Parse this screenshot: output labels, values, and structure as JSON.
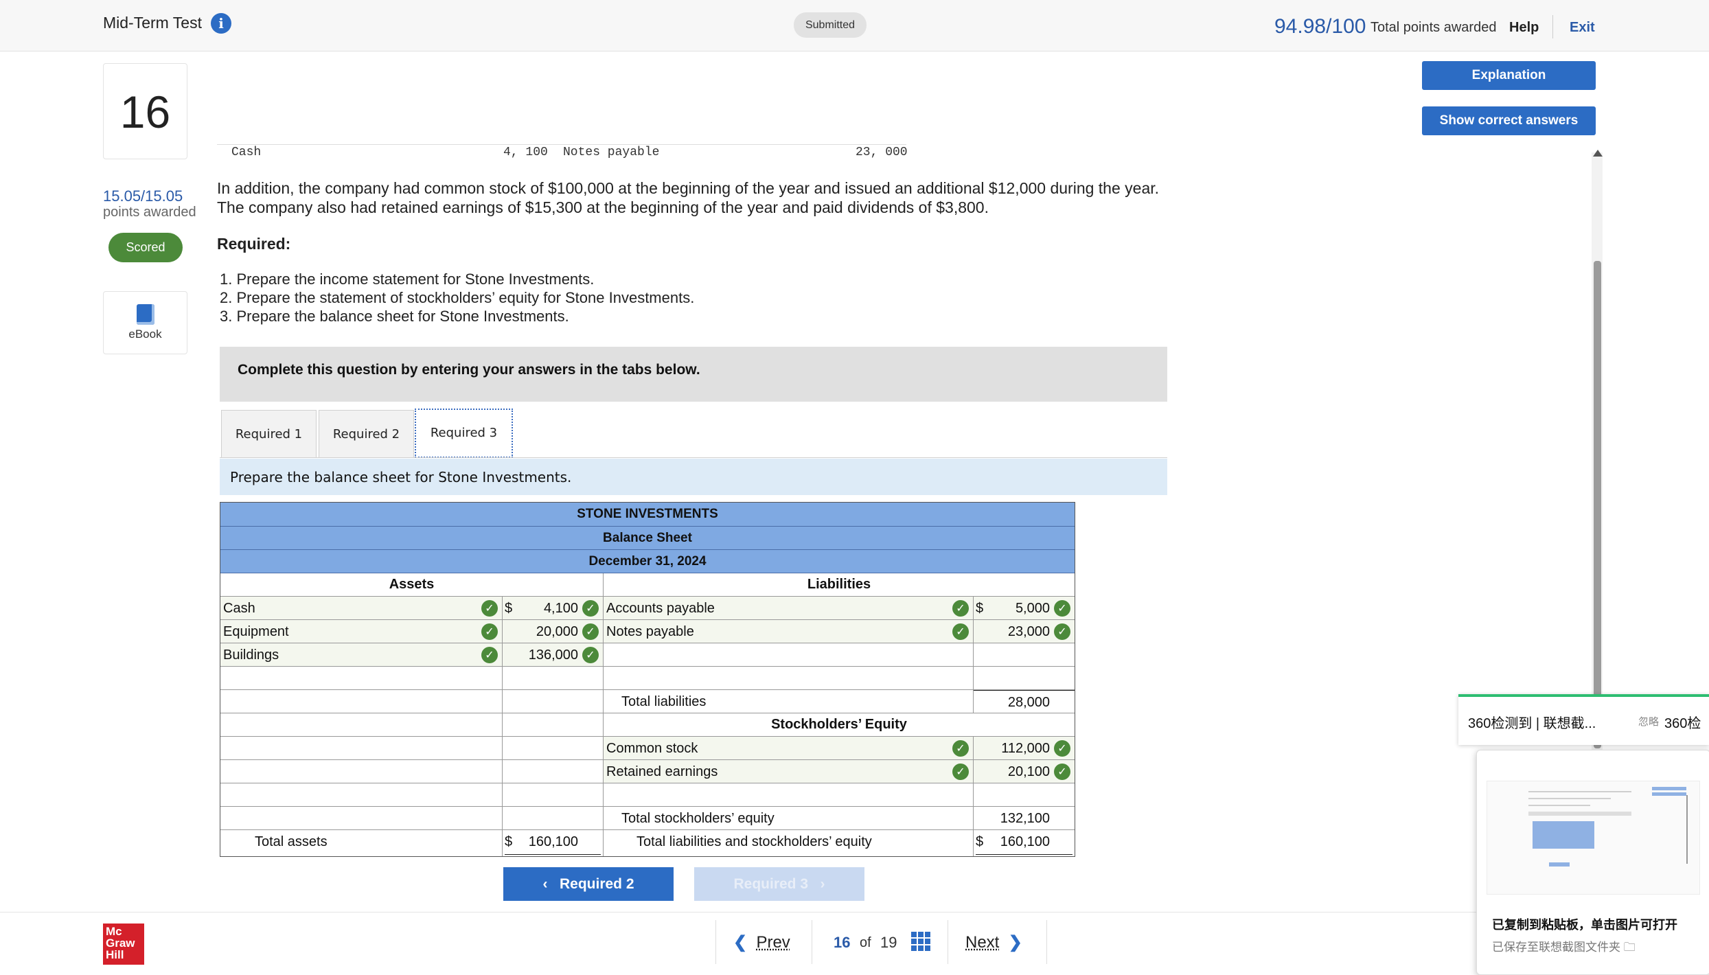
{
  "header": {
    "test_title": "Mid-Term Test",
    "info_icon": "i",
    "status_badge": "Submitted",
    "total_score": "94.98/100",
    "total_score_label": "Total points awarded",
    "help": "Help",
    "exit": "Exit"
  },
  "question": {
    "number": "16",
    "points": "15.05/15.05",
    "points_label": "points awarded",
    "status": "Scored",
    "ebook_label": "eBook"
  },
  "content": {
    "fragment": {
      "left_label": "Cash",
      "left_value": "4, 100",
      "right_label": "Notes payable",
      "right_value": "23, 000"
    },
    "paragraph": "In addition, the company had common stock of $100,000 at the beginning of the year and issued an additional $12,000 during the year. The company also had retained earnings of $15,300 at the beginning of the year and paid dividends of $3,800.",
    "required_label": "Required:",
    "required_items": [
      "1. Prepare the income statement for Stone Investments.",
      "2. Prepare the statement of stockholders’ equity for Stone Investments.",
      "3. Prepare the balance sheet for Stone Investments."
    ],
    "instruction": "Complete this question by entering your answers in the tabs below.",
    "tabs": [
      "Required 1",
      "Required 2",
      "Required 3"
    ],
    "prompt": "Prepare the balance sheet for Stone Investments."
  },
  "balance_sheet": {
    "company": "STONE INVESTMENTS",
    "statement": "Balance Sheet",
    "date": "December 31, 2024",
    "assets_header": "Assets",
    "liabilities_header": "Liabilities",
    "equity_header": "Stockholders’ Equity",
    "currency": "$",
    "assets": [
      {
        "label": "Cash",
        "value": "4,100"
      },
      {
        "label": "Equipment",
        "value": "20,000"
      },
      {
        "label": "Buildings",
        "value": "136,000"
      }
    ],
    "liabilities": [
      {
        "label": "Accounts payable",
        "value": "5,000"
      },
      {
        "label": "Notes payable",
        "value": "23,000"
      }
    ],
    "total_liabilities_label": "Total liabilities",
    "total_liabilities": "28,000",
    "equity": [
      {
        "label": "Common stock",
        "value": "112,000"
      },
      {
        "label": "Retained earnings",
        "value": "20,100"
      }
    ],
    "total_equity_label": "Total stockholders’ equity",
    "total_equity": "132,100",
    "total_assets_label": "Total assets",
    "total_assets": "160,100",
    "total_le_label": "Total liabilities and stockholders’ equity",
    "total_le": "160,100"
  },
  "tab_nav": {
    "prev_label": "Required 2",
    "next_label": "Required 3"
  },
  "side_buttons": {
    "explanation": "Explanation",
    "show_answers": "Show correct answers"
  },
  "footer": {
    "logo": "Mc Graw Hill",
    "prev": "Prev",
    "current": "16",
    "of": "of",
    "total": "19",
    "next": "Next"
  },
  "popup": {
    "banner_main": "360检测到 | 联想截...",
    "banner_dismiss": "忽略",
    "banner_right": "360检",
    "title": "已复制到粘贴板，单击图片可打开",
    "subtitle": "已保存至联想截图文件夹"
  },
  "colors": {
    "accent": "#2c6cc4",
    "score_text": "#2a5aa8",
    "scored_badge": "#4c8a3a",
    "table_header": "#7fa9e2",
    "prompt_bar": "#ddebf7",
    "check": "#4c8a3a"
  },
  "icons": [
    "info-icon",
    "book-icon",
    "check-icon",
    "chevron-left-icon",
    "chevron-right-icon",
    "grid-icon",
    "folder-icon"
  ]
}
